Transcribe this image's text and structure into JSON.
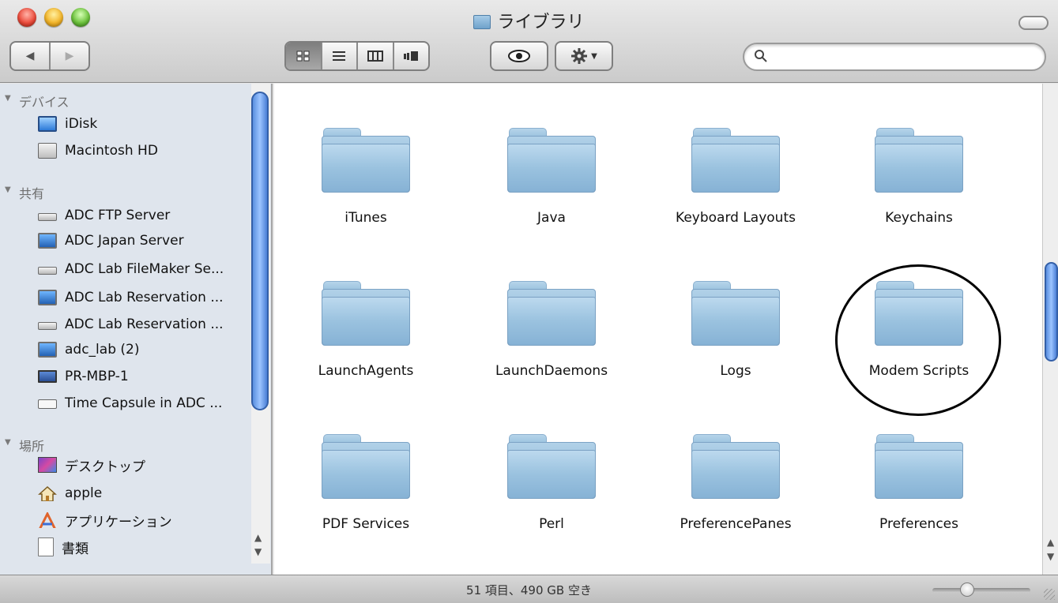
{
  "window": {
    "title": "ライブラリ"
  },
  "toolbar": {
    "nav": {
      "back_icon": "◀",
      "forward_icon": "▶"
    },
    "view_modes": [
      "icon-view",
      "list-view",
      "column-view",
      "coverflow-view"
    ],
    "active_view": "icon-view",
    "quick_look_icon": "eye-icon",
    "action_menu_icon": "gear-icon",
    "search": {
      "value": "",
      "placeholder": ""
    }
  },
  "sidebar": {
    "sections": [
      {
        "header": "デバイス",
        "items": [
          {
            "label": "iDisk",
            "icon": "idisk-icon"
          },
          {
            "label": "Macintosh HD",
            "icon": "hard-drive-icon"
          }
        ]
      },
      {
        "header": "共有",
        "items": [
          {
            "label": "ADC FTP Server",
            "icon": "server-icon"
          },
          {
            "label": "ADC Japan Server",
            "icon": "monitor-icon"
          },
          {
            "label": "ADC Lab FileMaker Se...",
            "icon": "server-icon"
          },
          {
            "label": "ADC Lab Reservation ...",
            "icon": "monitor-icon"
          },
          {
            "label": "ADC Lab Reservation ...",
            "icon": "server-icon"
          },
          {
            "label": "adc_lab (2)",
            "icon": "monitor-icon"
          },
          {
            "label": "PR-MBP-1",
            "icon": "laptop-icon"
          },
          {
            "label": "Time Capsule in ADC ...",
            "icon": "time-capsule-icon"
          }
        ]
      },
      {
        "header": "場所",
        "items": [
          {
            "label": "デスクトップ",
            "icon": "desktop-icon"
          },
          {
            "label": "apple",
            "icon": "home-icon"
          },
          {
            "label": "アプリケーション",
            "icon": "applications-icon"
          },
          {
            "label": "書類",
            "icon": "documents-icon"
          }
        ]
      }
    ]
  },
  "content": {
    "folders": [
      "iTunes",
      "Java",
      "Keyboard Layouts",
      "Keychains",
      "LaunchAgents",
      "LaunchDaemons",
      "Logs",
      "Modem Scripts",
      "PDF Services",
      "Perl",
      "PreferencePanes",
      "Preferences"
    ],
    "highlighted_folder": "Modem Scripts"
  },
  "status": {
    "text": "51 項目、490 GB 空き"
  },
  "icons": {
    "scroll_up": "▲",
    "scroll_down": "▼"
  }
}
